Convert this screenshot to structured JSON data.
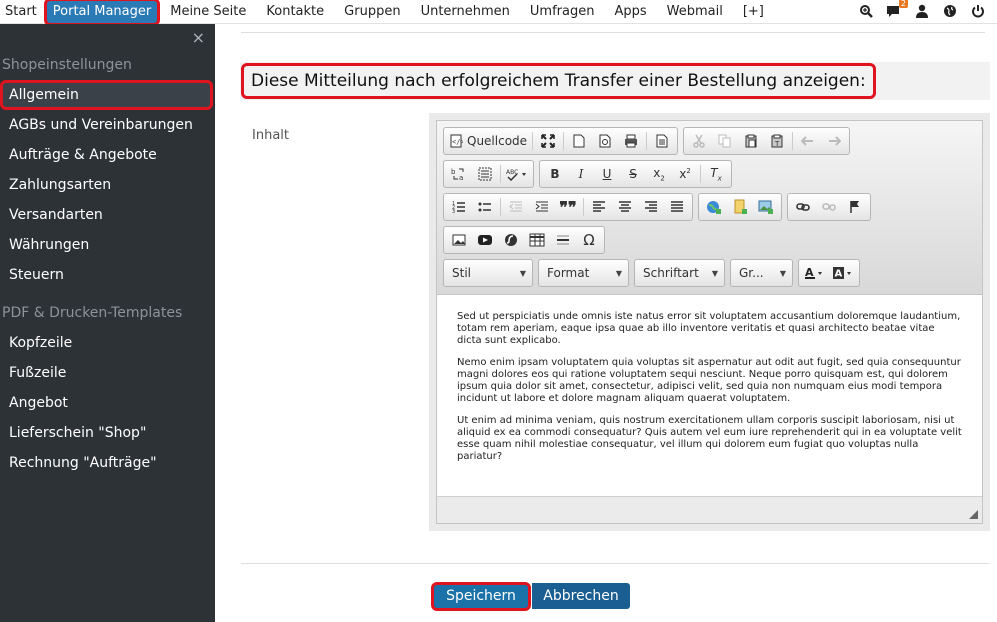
{
  "topnav": {
    "items": [
      "Start",
      "Portal Manager",
      "Meine Seite",
      "Kontakte",
      "Gruppen",
      "Unternehmen",
      "Umfragen",
      "Apps",
      "Webmail",
      "[+]"
    ],
    "notification_count": "2",
    "icons": [
      "zoom-icon",
      "chat-icon",
      "user-icon",
      "globe-icon",
      "power-icon"
    ]
  },
  "sidebar": {
    "close": "×",
    "section1": "Shopeinstellungen",
    "items1": [
      "Allgemein",
      "AGBs und Vereinbarungen",
      "Aufträge & Angebote",
      "Zahlungsarten",
      "Versandarten",
      "Währungen",
      "Steuern"
    ],
    "section2": "PDF & Drucken-Templates",
    "items2": [
      "Kopfzeile",
      "Fußzeile",
      "Angebot",
      "Lieferschein \"Shop\"",
      "Rechnung \"Aufträge\""
    ]
  },
  "main": {
    "title": "Diese Mitteilung nach erfolgreichem Transfer einer Bestellung anzeigen:",
    "field_label": "Inhalt"
  },
  "editor": {
    "source_label": "Quellcode",
    "combos": [
      "Stil",
      "Format",
      "Schriftart",
      "Gr..."
    ],
    "paragraphs": [
      "Sed ut perspiciatis unde omnis iste natus error sit voluptatem accusantium doloremque laudantium, totam rem aperiam, eaque ipsa quae ab illo inventore veritatis et quasi architecto beatae vitae dicta sunt explicabo.",
      "Nemo enim ipsam voluptatem quia voluptas sit aspernatur aut odit aut fugit, sed quia consequuntur magni dolores eos qui ratione voluptatem sequi nesciunt. Neque porro quisquam est, qui dolorem ipsum quia dolor sit amet, consectetur, adipisci velit, sed quia non numquam eius modi tempora incidunt ut labore et dolore magnam aliquam quaerat voluptatem.",
      "Ut enim ad minima veniam, quis nostrum exercitationem ullam corporis suscipit laboriosam, nisi ut aliquid ex ea commodi consequatur? Quis autem vel eum iure reprehenderit qui in ea voluptate velit esse quam nihil molestiae consequatur, vel illum qui dolorem eum fugiat quo voluptas nulla pariatur?"
    ]
  },
  "buttons": {
    "save": "Speichern",
    "cancel": "Abbrechen"
  },
  "colors": {
    "accent": "#2a7ab5",
    "highlight": "#e0141e",
    "sidebar_bg": "#2d3237"
  }
}
